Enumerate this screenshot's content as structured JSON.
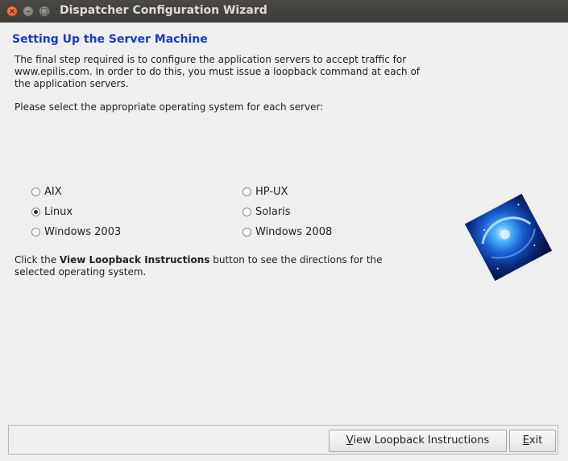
{
  "window": {
    "title": "Dispatcher Configuration Wizard",
    "close_glyph": "×",
    "minimize_glyph": "–",
    "maximize_glyph": "□"
  },
  "content": {
    "heading": "Setting Up the Server Machine",
    "intro": "The final step required is to configure the application servers to accept traffic for www.epilis.com. In order to do this, you must issue a loopback command at each of the application servers.",
    "select_prompt": "Please select the appropriate operating system for each server:",
    "instructions_pre": "Click the ",
    "instructions_bold": "View Loopback Instructions",
    "instructions_post": " button to see the directions for the selected operating system."
  },
  "os_options": {
    "aix": "AIX",
    "linux": "Linux",
    "windows_2003": "Windows 2003",
    "hpux": "HP-UX",
    "solaris": "Solaris",
    "windows_2008": "Windows 2008",
    "selected": "Linux"
  },
  "buttons": {
    "view_mnemonic": "V",
    "view_rest": "iew Loopback Instructions",
    "exit_mnemonic": "E",
    "exit_rest": "xit"
  },
  "colors": {
    "heading": "#1a3bc8",
    "titlebar": "#3c3b37",
    "close_button": "#e2531c",
    "background": "#efefef"
  },
  "icons": {
    "logo": "galaxy-image"
  }
}
